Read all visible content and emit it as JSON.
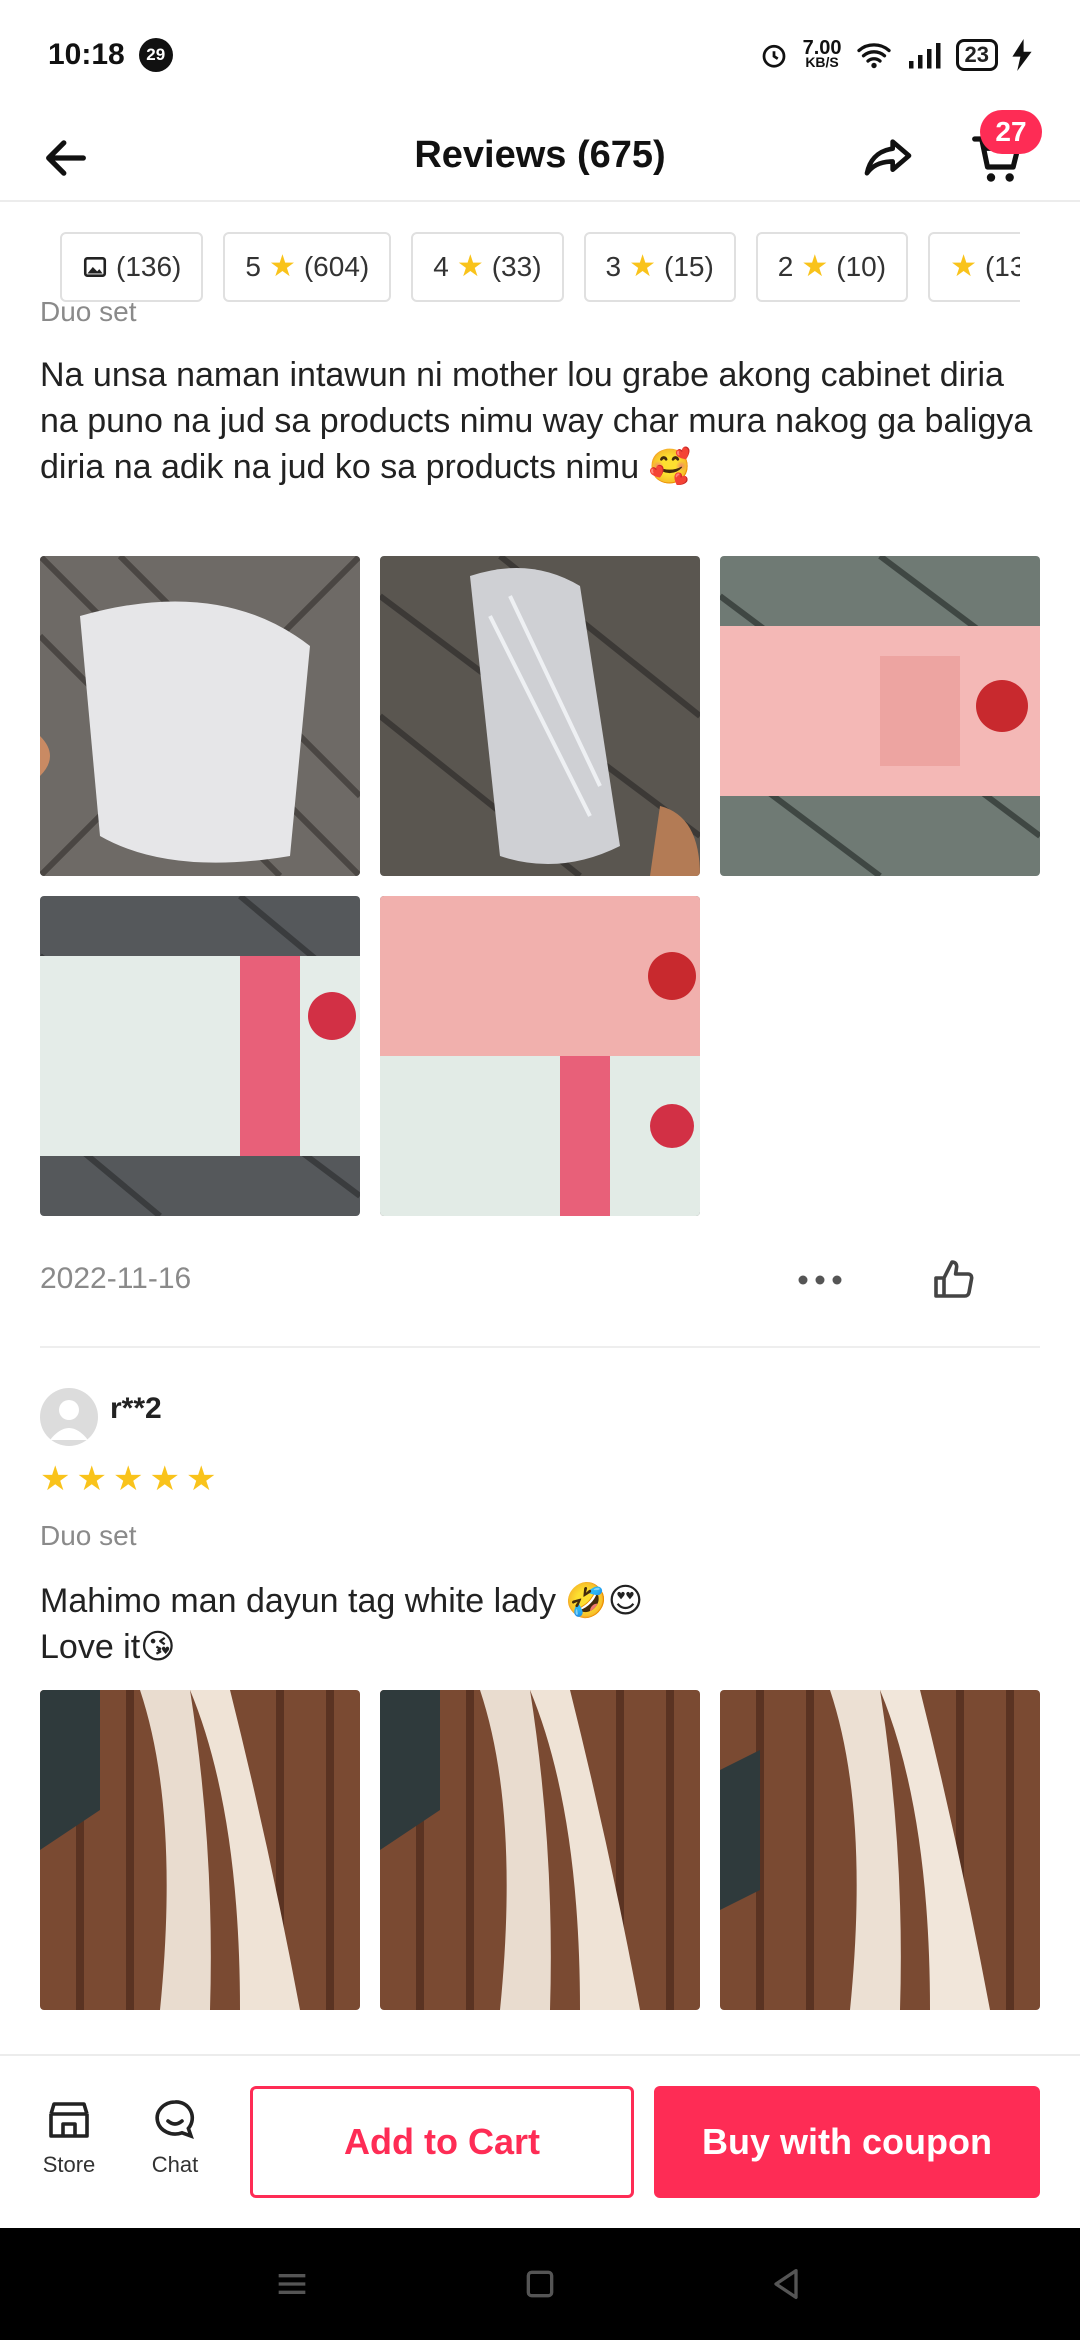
{
  "status": {
    "time": "10:18",
    "notif_count": "29",
    "speed_value": "7.00",
    "speed_unit": "KB/S",
    "battery": "23"
  },
  "header": {
    "title": "Reviews (675)",
    "cart_count": "27"
  },
  "filters": [
    {
      "icon": "image-icon",
      "label": "(136)"
    },
    {
      "num": "5",
      "label": "(604)"
    },
    {
      "num": "4",
      "label": "(33)"
    },
    {
      "num": "3",
      "label": "(15)"
    },
    {
      "num": "2",
      "label": "(10)"
    },
    {
      "num": "",
      "label": "(13"
    }
  ],
  "review1": {
    "variant": "Duo set",
    "text": "Na unsa naman intawun ni mother lou grabe akong cabinet diria na puno na jud sa products nimu way char mura nakog ga baligya diria na adik na jud ko sa products nimu 🥰",
    "date": "2022-11-16"
  },
  "review2": {
    "username": "r**2",
    "rating": 5,
    "variant": "Duo set",
    "text_line1": "Mahimo man dayun tag white lady 🤣😍",
    "text_line2": "Love it😘"
  },
  "bottom": {
    "store_label": "Store",
    "chat_label": "Chat",
    "add_to_cart": "Add to Cart",
    "buy_coupon": "Buy with coupon"
  },
  "colors": {
    "accent": "#fe2c55",
    "star": "#f9c31b"
  }
}
